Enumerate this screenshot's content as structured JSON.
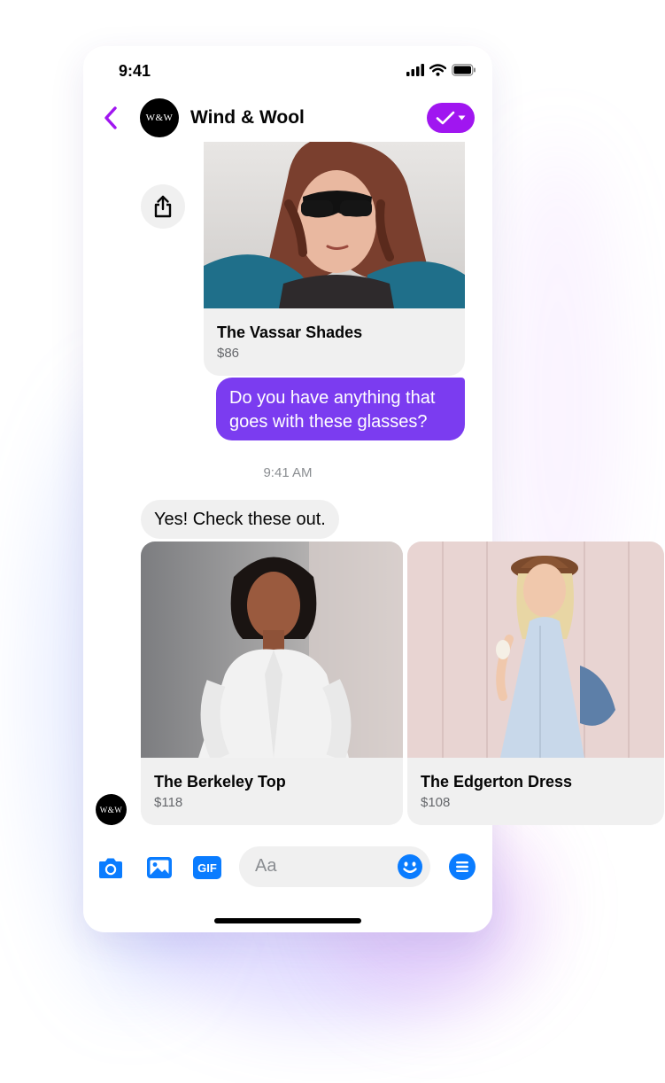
{
  "status_bar": {
    "time": "9:41"
  },
  "header": {
    "title": "Wind & Wool",
    "avatar_text": "W&W"
  },
  "colors": {
    "accent": "#a016f0",
    "outgoing_bubble": "#7b3cf0",
    "messenger_blue": "#0a7cff",
    "incoming_bubble": "#f0f0f0"
  },
  "messages": {
    "product_shared": {
      "title": "The Vassar Shades",
      "price": "$86"
    },
    "outgoing": "Do you have anything that goes with these glasses?",
    "timestamp": "9:41 AM",
    "incoming": "Yes! Check these out.",
    "carousel": [
      {
        "title": "The Berkeley Top",
        "price": "$118"
      },
      {
        "title": "The Edgerton Dress",
        "price": "$108"
      }
    ]
  },
  "composer": {
    "placeholder": "Aa",
    "icons": [
      "camera-icon",
      "gallery-icon",
      "gif-icon",
      "emoji-icon",
      "menu-icon"
    ],
    "gif_label": "GIF"
  }
}
